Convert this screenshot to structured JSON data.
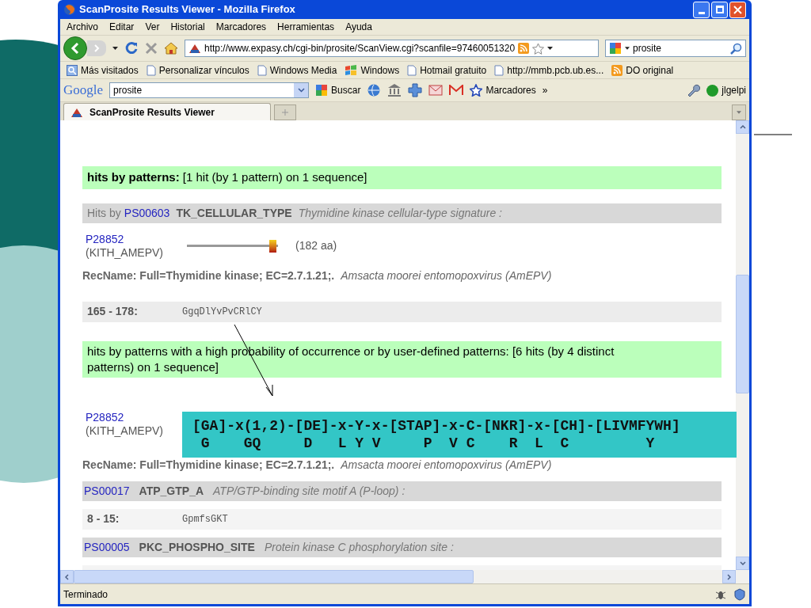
{
  "window": {
    "title": "ScanProsite Results Viewer - Mozilla Firefox"
  },
  "menu": [
    "Archivo",
    "Editar",
    "Ver",
    "Historial",
    "Marcadores",
    "Herramientas",
    "Ayuda"
  ],
  "address": {
    "url": "http://www.expasy.ch/cgi-bin/prosite/ScanView.cgi?scanfile=97460051320"
  },
  "search": {
    "value": "prosite"
  },
  "bookmarks": [
    {
      "label": "Más visitados",
      "kind": "smart"
    },
    {
      "label": "Personalizar vínculos",
      "kind": "page"
    },
    {
      "label": "Windows Media",
      "kind": "page"
    },
    {
      "label": "Windows",
      "kind": "windows"
    },
    {
      "label": "Hotmail gratuito",
      "kind": "page"
    },
    {
      "label": "http://mmb.pcb.ub.es...",
      "kind": "page"
    },
    {
      "label": "DO original",
      "kind": "feed"
    }
  ],
  "google_toolbar": {
    "logo": "Google",
    "query": "prosite",
    "search_button": "Buscar",
    "bookmarks_button": "Marcadores",
    "more": "»",
    "user": "jlgelpi"
  },
  "tabs": [
    {
      "label": "ScanProsite Results Viewer",
      "selected": true
    }
  ],
  "content": {
    "section1": {
      "heading": "**hits by patterns:** [1 hit (by 1 pattern) on 1 sequence]",
      "pattern_row": {
        "prefix": "Hits by",
        "accession": "PS00603",
        "name": "TK_CELLULAR_TYPE",
        "description": "Thymidine kinase cellular-type signature :"
      },
      "sequence": {
        "accession": "P28852",
        "entry": "(KITH_AMEPV)",
        "length": "(182 aa)",
        "recname": "RecName: Full=Thymidine kinase; EC=2.7.1.21;.",
        "organism": "Amsacta moorei entomopoxvirus (AmEPV)"
      },
      "hit": {
        "range": "165 - 178:",
        "match": "GgqDlYvPvCRlCY"
      }
    },
    "section2": {
      "heading": "hits by patterns with a high probability of occurrence or by user-defined patterns: [6 hits (by 4 distinct patterns) on 1 sequence]",
      "sequence": {
        "accession": "P28852",
        "entry": "(KITH_AMEPV)",
        "recname": "RecName: Full=Thymidine kinase; EC=2.7.1.21;.",
        "organism": "Amsacta moorei entomopoxvirus (AmEPV)"
      },
      "patterns": [
        {
          "accession": "PS00017",
          "name": "ATP_GTP_A",
          "description": "ATP/GTP-binding site motif A (P-loop) :",
          "hits": [
            {
              "range": "8 - 15:",
              "match": "GpmfsGKT"
            }
          ]
        },
        {
          "accession": "PS00005",
          "name": "PKC_PHOSPHO_SITE",
          "description": "Protein kinase C phosphorylation site :"
        }
      ]
    }
  },
  "status_bar": {
    "text": "Terminado"
  },
  "callout": {
    "pattern": "[GA]-x(1,2)-[DE]-x-Y-x-[STAP]-x-C-[NKR]-x-[CH]-[LIVMFYWH]",
    "residues": " G    GQ     D   L Y V     P  V C    R  L  C         Y"
  }
}
